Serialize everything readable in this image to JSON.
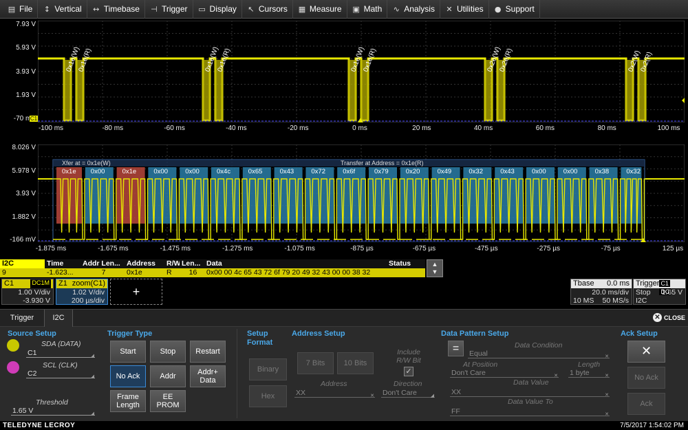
{
  "menu": [
    {
      "label": "File",
      "icon": "file-icon",
      "glyph": "▤"
    },
    {
      "label": "Vertical",
      "icon": "vertical-arrows-icon",
      "glyph": "↕"
    },
    {
      "label": "Timebase",
      "icon": "horizontal-arrows-icon",
      "glyph": "↔"
    },
    {
      "label": "Trigger",
      "icon": "trigger-icon",
      "glyph": "⊣"
    },
    {
      "label": "Display",
      "icon": "display-icon",
      "glyph": "▭"
    },
    {
      "label": "Cursors",
      "icon": "cursor-icon",
      "glyph": "↖"
    },
    {
      "label": "Measure",
      "icon": "measure-icon",
      "glyph": "▦"
    },
    {
      "label": "Math",
      "icon": "math-icon",
      "glyph": "▣"
    },
    {
      "label": "Analysis",
      "icon": "analysis-icon",
      "glyph": "∿"
    },
    {
      "label": "Utilities",
      "icon": "utilities-icon",
      "glyph": "✕"
    },
    {
      "label": "Support",
      "icon": "support-icon",
      "glyph": "●"
    }
  ],
  "grid1": {
    "volt_labels": [
      "7.93 V",
      "5.93 V",
      "3.93 V",
      "1.93 V",
      "-70 mV"
    ],
    "time_labels": [
      "-100 ms",
      "-80 ms",
      "-60 ms",
      "-40 ms",
      "-20 ms",
      "0 ms",
      "20 ms",
      "40 ms",
      "60 ms",
      "80 ms",
      "100 ms"
    ],
    "channel_tag": "C1",
    "annotations": [
      {
        "t": "0x1e(W)",
        "t2": "0x1e(R)"
      },
      {
        "t": "0x1e(W)",
        "t2": "0x1e(R)"
      },
      {
        "t": "0x1e(W)",
        "t2": "0x1e(R)"
      },
      {
        "t": "0x2e(W)",
        "t2": "0x2e(R)"
      },
      {
        "t": "0x2(W)",
        "t2": "0x2(R)"
      }
    ]
  },
  "grid2": {
    "volt_labels": [
      "8.026 V",
      "5.978 V",
      "3.93 V",
      "1.882 V",
      "-166 mV"
    ],
    "time_labels": [
      "-1.875 ms",
      "-1.675 ms",
      "-1.475 ms",
      "-1.275 ms",
      "-1.075 ms",
      "-875 µs",
      "-675 µs",
      "-475 µs",
      "-275 µs",
      "-75 µs",
      "125 µs"
    ],
    "xfer_label": "Xfer at = 0x1e(W)",
    "transfer_label": "Transfer at Address = 0x1e(R)",
    "bytes": [
      "0x1e",
      "0x00",
      "0x1e",
      "0x00",
      "0x00",
      "0x4c",
      "0x65",
      "0x43",
      "0x72",
      "0x6f",
      "0x79",
      "0x20",
      "0x49",
      "0x32",
      "0x43",
      "0x00",
      "0x00",
      "0x38",
      "0x32"
    ]
  },
  "decode": {
    "tag": "I2C",
    "headers": [
      "Index",
      "Time",
      "Addr Len...",
      "Address",
      "R/W",
      "Len...",
      "Data",
      "Status"
    ],
    "row": {
      "index": "9",
      "time": "-1.623...",
      "addr_len": "7",
      "address": "0x1e",
      "rw": "R",
      "len": "16",
      "data": "0x00 00 4c 65 43 72 6f 79 20 49 32 43 00 00 38 32",
      "status": ""
    }
  },
  "descriptors": {
    "c1": {
      "name": "C1",
      "badge": "DC1M",
      "l1": "1.00 V/div",
      "l2": "-3.930 V"
    },
    "z1": {
      "name": "Z1",
      "badge": "zoom(C1)",
      "l1": "1.02 V/div",
      "l2": "200 µs/div"
    },
    "add": "+",
    "tbase": {
      "name": "Tbase",
      "value": "0.0 ms",
      "l1": "20.0 ms/div",
      "l2a": "10 MS",
      "l2b": "50 MS/s"
    },
    "trigger": {
      "name": "Trigger",
      "badge1": "C1",
      "badge2": "DC",
      "l1a": "Stop",
      "l1b": "1.65 V",
      "l2": "I2C"
    }
  },
  "dialog": {
    "tabs": [
      "Trigger",
      "I2C"
    ],
    "close": "CLOSE",
    "source_setup": {
      "title": "Source Setup",
      "sda_label": "SDA (DATA)",
      "sda_value": "C1",
      "scl_label": "SCL (CLK)",
      "scl_value": "C2",
      "threshold_label": "Threshold",
      "threshold_value": "1.65 V"
    },
    "trigger_type": {
      "title": "Trigger Type",
      "buttons": [
        "Start",
        "Stop",
        "Restart",
        "No Ack",
        "Addr",
        "Addr+ Data",
        "Frame Length",
        "EE PROM"
      ]
    },
    "setup_format": {
      "title": "Setup Format",
      "binary": "Binary",
      "hex": "Hex"
    },
    "address_setup": {
      "title": "Address Setup",
      "bits7": "7 Bits",
      "bits10": "10 Bits",
      "include_rw": "Include R/W Bit",
      "address_label": "Address",
      "address_value": "XX",
      "direction_label": "Direction",
      "direction_value": "Don't Care"
    },
    "data_pattern": {
      "title": "Data Pattern Setup",
      "eq": "=",
      "condition_label": "Data Condition",
      "condition_value": "Equal",
      "position_label": "At Position",
      "position_value": "Don't Care",
      "length_label": "Length",
      "length_value": "1 byte",
      "value_label": "Data Value",
      "value_value": "XX",
      "value_to_label": "Data Value To",
      "value_to_value": "FF"
    },
    "ack_setup": {
      "title": "Ack Setup",
      "x": "✕",
      "no_ack": "No Ack",
      "ack": "Ack"
    }
  },
  "status": {
    "brand": "TELEDYNE LECROY",
    "clock": "7/5/2017 1:54:02 PM"
  },
  "colors": {
    "trace": "#e8e800",
    "accent": "#4aa8e8",
    "address_box": "#b8483c",
    "data_box": "#2a7ea8"
  }
}
